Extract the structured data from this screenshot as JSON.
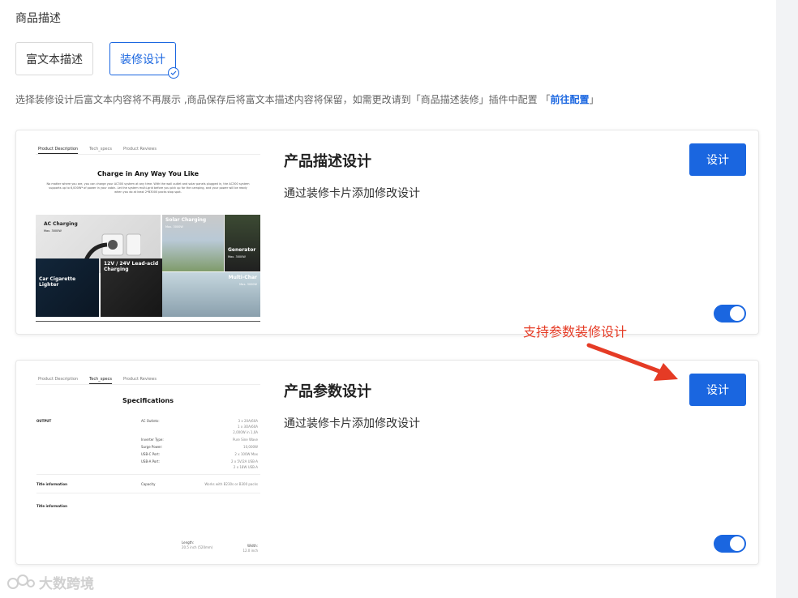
{
  "section_title": "商品描述",
  "mode_buttons": {
    "rich_text": "富文本描述",
    "decoration": "装修设计"
  },
  "hint": {
    "text": "选择装修设计后富文本内容将不再展示 ,商品保存后将富文本描述内容将保留，如需更改请到「商品描述装修」插件中配置 「",
    "link": "前往配置",
    "tail": "」"
  },
  "cards": [
    {
      "title": "产品描述设计",
      "desc": "通过装修卡片添加修改设计",
      "button": "设计",
      "toggle_on": true,
      "preview": {
        "tabs": [
          "Product Description",
          "Tech_specs",
          "Product Reviews"
        ],
        "heading": "Charge in Any Way You Like",
        "paragraph": "No matter where you are, you can charge your AC300 system at any time. With the wall outlet and solar panels plugged in, the AC300 system supports up to 6,000W* of power in your cabin. Let the system multi-grid before you pick up for the camping, and your power will be ready when you do at least 2*B3000 packs stop spot.",
        "tiles": {
          "ac": {
            "title": "AC Charging",
            "sub": "Max. 3000W"
          },
          "solar": {
            "title": "Solar Charging",
            "sub": "Max. 3000W"
          },
          "gen": {
            "title": "Generator",
            "sub": "Max. 3000W"
          },
          "car": {
            "title": "Car Cigarette Lighter",
            "sub": ""
          },
          "lead": {
            "title": "12V / 24V Lead-acid Charging",
            "sub": ""
          },
          "multi": {
            "title": "Multi-Char",
            "sub": "Max. 3000W"
          }
        }
      }
    },
    {
      "title": "产品参数设计",
      "desc": "通过装修卡片添加修改设计",
      "button": "设计",
      "toggle_on": true,
      "preview": {
        "tabs": [
          "Product Description",
          "Tech_specs",
          "Product Reviews"
        ],
        "heading": "Specifications",
        "output_label": "OUTPUT",
        "rows": [
          {
            "k": "AC Outlets:",
            "v": "3 x 20A/60A"
          },
          {
            "k": "",
            "v": "1 x 3OA/60A"
          },
          {
            "k": "",
            "v": "2,000W in 1,0A"
          },
          {
            "k": "Inverter Type:",
            "v": "Pure Sine Wave"
          },
          {
            "k": "Surge Power:",
            "v": "10,000W"
          },
          {
            "k": "USB-C Port:",
            "v": "2 x 100W Max"
          },
          {
            "k": "USB-A Port:",
            "v": "2 x 5V/2A USB-A"
          },
          {
            "k": "",
            "v": "2 x 18W USB-A"
          }
        ],
        "title_info_1": "Title information",
        "capacity_label": "Capacity",
        "capacity_value": "Works with B230s or B300 packs",
        "title_info_2": "Title information",
        "length_label": "Length:",
        "length_value": "20.5 inch (520mm)",
        "width_label": "Width:",
        "width_value": "12.0 inch"
      }
    }
  ],
  "annotation": "支持参数装修设计",
  "watermark": "大数跨境",
  "colors": {
    "primary": "#1a66e0",
    "annotation": "#e53b25"
  }
}
